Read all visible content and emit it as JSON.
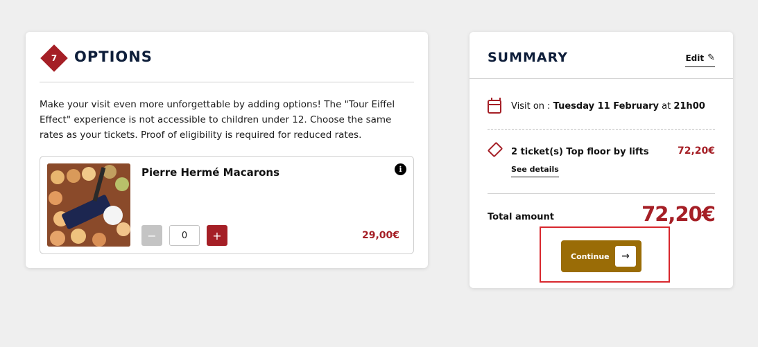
{
  "options": {
    "step_number": "7",
    "title": "OPTIONS",
    "description": "Make your visit even more unforgettable by adding options! The \"Tour Eiffel Effect\" experience is not accessible to children under 12. Choose the same rates as your tickets. Proof of eligibility is required for reduced rates.",
    "product": {
      "name": "Pierre Hermé Macarons",
      "info_icon": "i",
      "minus_label": "−",
      "quantity": "0",
      "plus_label": "+",
      "price": "29,00€"
    }
  },
  "summary": {
    "title": "SUMMARY",
    "edit_label": "Edit",
    "edit_icon": "✎",
    "visit_prefix": "Visit on : ",
    "visit_date": "Tuesday 11 February",
    "visit_at": " at ",
    "visit_time": "21h00",
    "ticket_label": "2 ticket(s) Top floor by lifts",
    "ticket_price": "72,20€",
    "see_details": "See details",
    "total_label": "Total amount",
    "total_value": "72,20€",
    "continue_label": "Continue",
    "continue_arrow": "→"
  },
  "colors": {
    "brand_red": "#a51f26",
    "continue_gold": "#9a6c06",
    "title_navy": "#0e1e3a",
    "highlight_red": "#d8272d"
  }
}
